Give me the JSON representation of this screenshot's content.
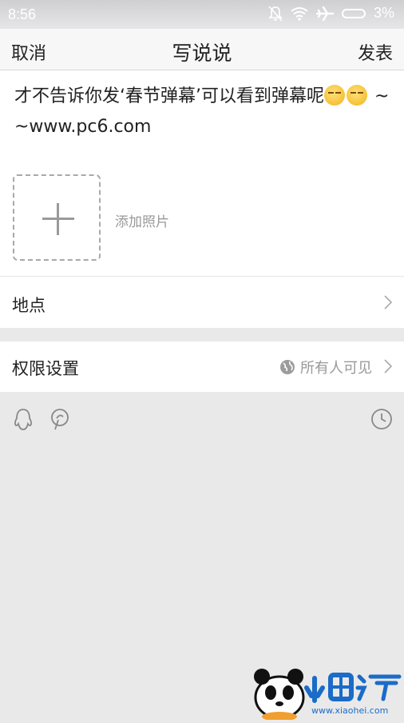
{
  "status_bar": {
    "time": "8:56",
    "battery_percent": "3%",
    "icons": [
      "bell-muted-icon",
      "wifi-icon",
      "airplane-icon",
      "battery-icon"
    ]
  },
  "nav": {
    "cancel_label": "取消",
    "title": "写说说",
    "publish_label": "发表"
  },
  "compose": {
    "text_before_emoji": "才不告诉你发‘春节弹幕’可以看到弹幕呢",
    "emojis": [
      "smirk-emoji",
      "smirk-emoji"
    ],
    "text_after_emoji": " ~ ~www.pc6.com",
    "add_photo_label": "添加照片"
  },
  "location": {
    "label": "地点"
  },
  "privacy": {
    "label": "权限设置",
    "value": "所有人可见"
  },
  "toolbar": {
    "icons": [
      "qq-icon",
      "mention-icon",
      "clock-icon"
    ]
  },
  "watermark": {
    "brand": "小黑游戏",
    "url": "www.xiaohei.com"
  },
  "colors": {
    "background": "#e9e9ea",
    "panel": "#ffffff",
    "muted_text": "#999999",
    "status_bar": "#d6d6d8"
  }
}
